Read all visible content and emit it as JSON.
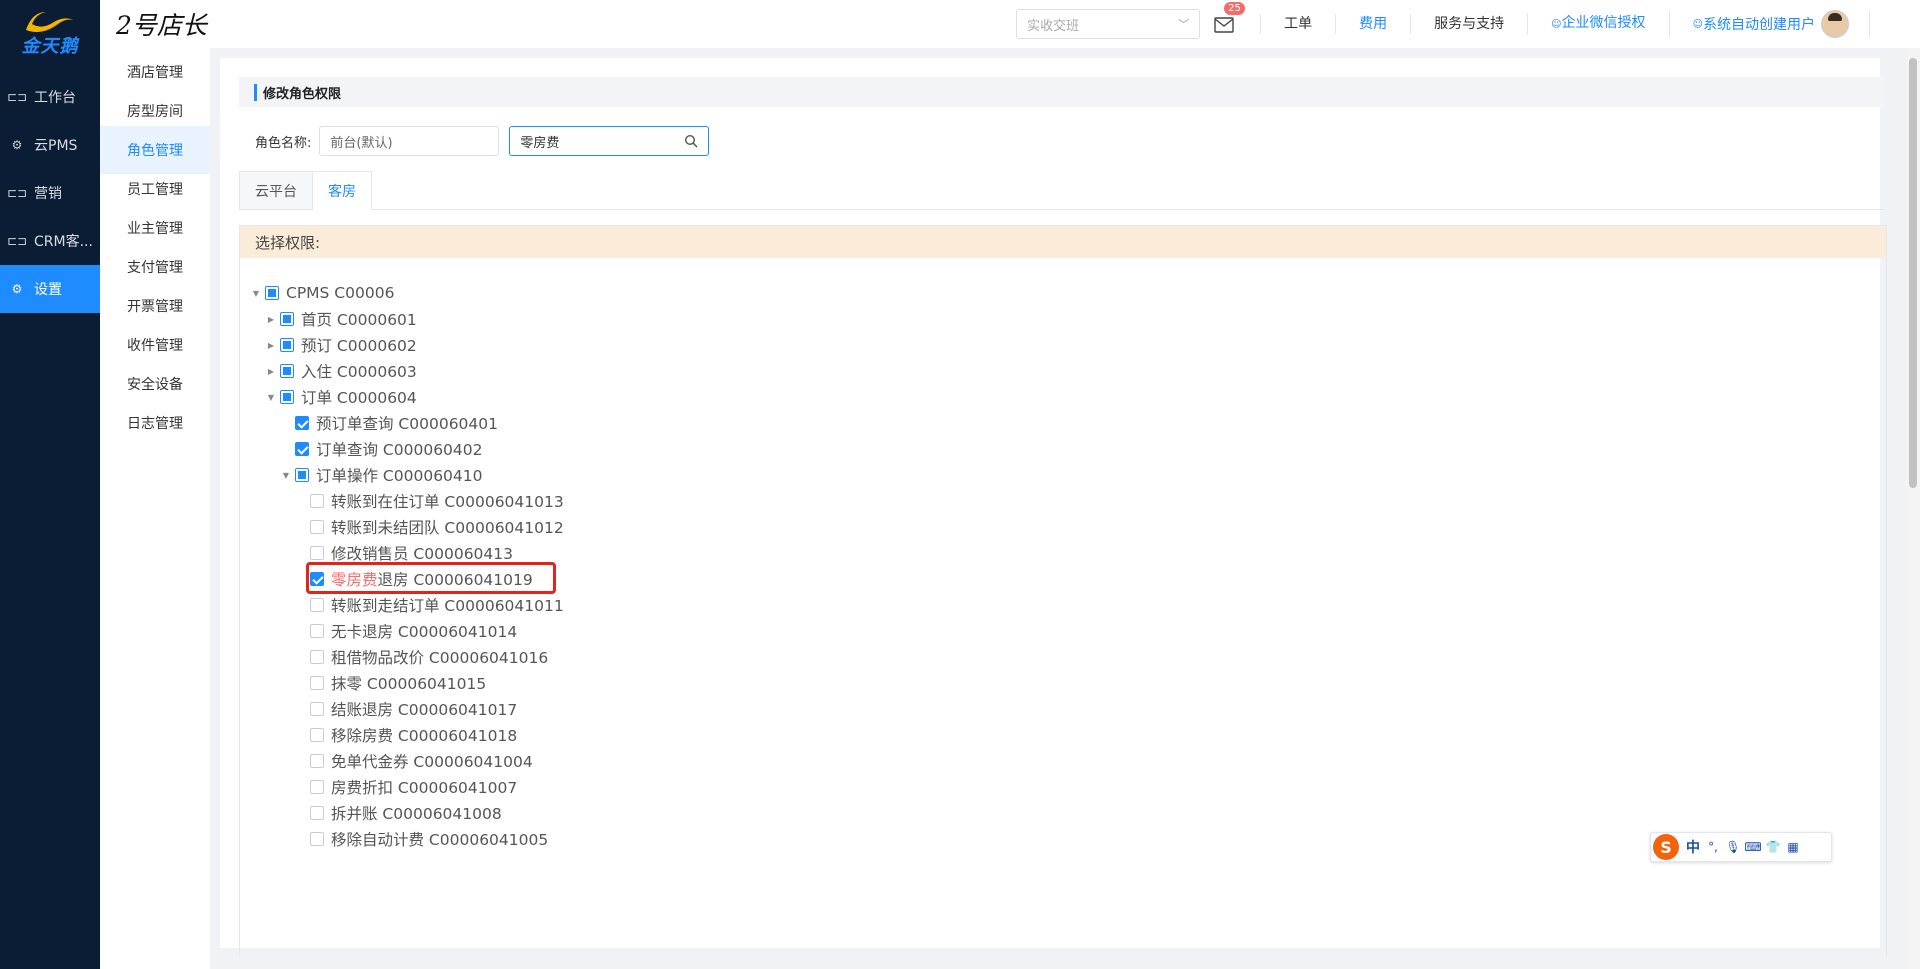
{
  "sidebar": {
    "logo_text": "金天鹅",
    "items": [
      {
        "label": "工作台",
        "icon": "dashboard-icon"
      },
      {
        "label": "云PMS",
        "icon": "gear-icon"
      },
      {
        "label": "营销",
        "icon": "marketing-icon"
      },
      {
        "label": "CRM客...",
        "icon": "crm-icon"
      },
      {
        "label": "设置",
        "icon": "settings-icon",
        "active": true
      }
    ]
  },
  "header": {
    "brand": "2号店长",
    "shift_placeholder": "实收交班",
    "mail_count": "25",
    "links": [
      "工单",
      "费用",
      "服务与支持",
      "企业微信授权"
    ],
    "user_name": "系统自动创建用户"
  },
  "submenu": {
    "items": [
      "酒店管理",
      "房型房间",
      "角色管理",
      "员工管理",
      "业主管理",
      "支付管理",
      "开票管理",
      "收件管理",
      "安全设备",
      "日志管理"
    ],
    "active_index": 2
  },
  "main": {
    "section_title": "修改角色权限",
    "role_label": "角色名称:",
    "role_value": "前台(默认)",
    "search_value": "零房费",
    "tabs": [
      "云平台",
      "客房"
    ],
    "active_tab": 1,
    "perm_header": "选择权限:",
    "tree": [
      {
        "label": "CPMS C00006",
        "level": 0,
        "state": "half",
        "arrow": "down"
      },
      {
        "label": "首页 C0000601",
        "level": 1,
        "state": "half",
        "arrow": "right"
      },
      {
        "label": "预订 C0000602",
        "level": 1,
        "state": "half",
        "arrow": "right"
      },
      {
        "label": "入住 C0000603",
        "level": 1,
        "state": "half",
        "arrow": "right"
      },
      {
        "label": "订单 C0000604",
        "level": 1,
        "state": "half",
        "arrow": "down"
      },
      {
        "label": "预订单查询 C000060401",
        "level": 2,
        "state": "checked",
        "arrow": "none"
      },
      {
        "label": "订单查询 C000060402",
        "level": 2,
        "state": "checked",
        "arrow": "none"
      },
      {
        "label": "订单操作 C000060410",
        "level": 2,
        "state": "half",
        "arrow": "down"
      },
      {
        "label": "转账到在住订单 C00006041013",
        "level": 3,
        "state": "none",
        "arrow": "none"
      },
      {
        "label": "转账到未结团队 C00006041012",
        "level": 3,
        "state": "none",
        "arrow": "none"
      },
      {
        "label": "修改销售员 C000060413",
        "level": 3,
        "state": "none",
        "arrow": "none"
      },
      {
        "label": "退房 C00006041019",
        "highlight": "零房费",
        "level": 3,
        "state": "checked",
        "arrow": "none"
      },
      {
        "label": "转账到走结订单 C00006041011",
        "level": 3,
        "state": "none",
        "arrow": "none"
      },
      {
        "label": "无卡退房 C00006041014",
        "level": 3,
        "state": "none",
        "arrow": "none"
      },
      {
        "label": "租借物品改价 C00006041016",
        "level": 3,
        "state": "none",
        "arrow": "none"
      },
      {
        "label": "抹零 C00006041015",
        "level": 3,
        "state": "none",
        "arrow": "none"
      },
      {
        "label": "结账退房 C00006041017",
        "level": 3,
        "state": "none",
        "arrow": "none"
      },
      {
        "label": "移除房费 C00006041018",
        "level": 3,
        "state": "none",
        "arrow": "none"
      },
      {
        "label": "免单代金券 C00006041004",
        "level": 3,
        "state": "none",
        "arrow": "none"
      },
      {
        "label": "房费折扣 C00006041007",
        "level": 3,
        "state": "none",
        "arrow": "none"
      },
      {
        "label": "拆并账 C00006041008",
        "level": 3,
        "state": "none",
        "arrow": "none"
      },
      {
        "label": "移除自动计费 C00006041005",
        "level": 3,
        "state": "none",
        "arrow": "none"
      }
    ]
  },
  "ime": {
    "lang": "中",
    "punct": "°,"
  }
}
